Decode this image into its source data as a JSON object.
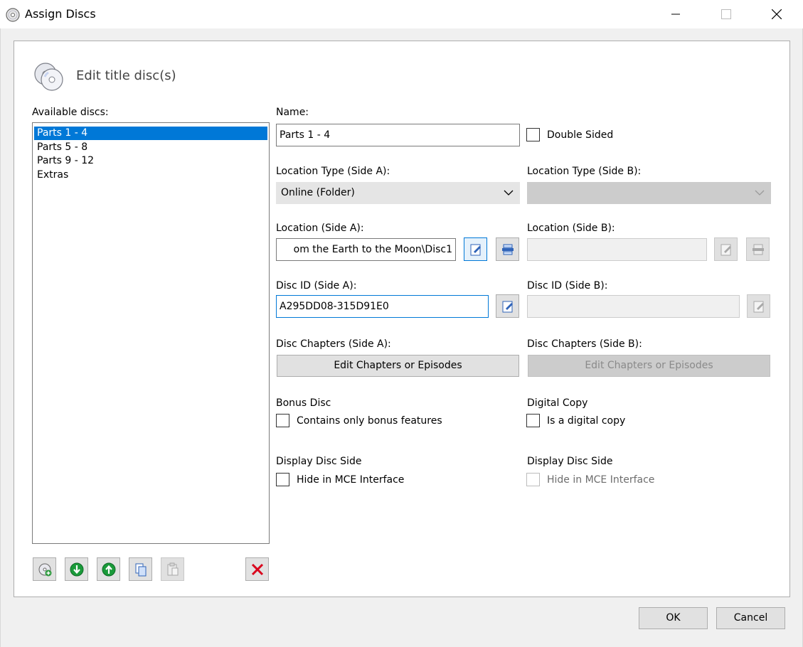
{
  "window": {
    "title": "Assign Discs"
  },
  "header": {
    "title": "Edit title disc(s)"
  },
  "discs": {
    "label": "Available discs:",
    "items": [
      "Parts 1 - 4",
      "Parts 5 - 8",
      "Parts 9 - 12",
      "Extras"
    ],
    "selected_index": 0
  },
  "name": {
    "label": "Name:",
    "value": "Parts 1 - 4",
    "double_sided_label": "Double Sided",
    "double_sided_checked": false
  },
  "side_a": {
    "location_type_label": "Location Type (Side A):",
    "location_type_value": "Online (Folder)",
    "location_label": "Location (Side A):",
    "location_value": "om the Earth to the Moon\\Disc1",
    "disc_id_label": "Disc ID (Side A):",
    "disc_id_value": "A295DD08-315D91E0",
    "chapters_label": "Disc Chapters (Side A):",
    "chapters_button": "Edit Chapters or Episodes",
    "bonus_heading": "Bonus Disc",
    "bonus_checkbox": "Contains only bonus features",
    "display_heading": "Display Disc Side",
    "display_checkbox": "Hide in MCE Interface"
  },
  "side_b": {
    "location_type_label": "Location Type (Side B):",
    "location_type_value": "",
    "location_label": "Location (Side B):",
    "location_value": "",
    "disc_id_label": "Disc ID (Side B):",
    "disc_id_value": "",
    "chapters_label": "Disc Chapters (Side B):",
    "chapters_button": "Edit Chapters or Episodes",
    "digital_heading": "Digital Copy",
    "digital_checkbox": "Is a digital copy",
    "display_heading": "Display Disc Side",
    "display_checkbox": "Hide in MCE Interface"
  },
  "toolbar": {
    "icons": [
      "add-disc-icon",
      "move-down-icon",
      "move-up-icon",
      "copy-icon",
      "paste-icon",
      "delete-icon"
    ]
  },
  "footer": {
    "ok_label": "OK",
    "cancel_label": "Cancel"
  },
  "colors": {
    "accent": "#0078d7",
    "delete": "#d9001b",
    "arrow_green": "#1a9a3a"
  }
}
